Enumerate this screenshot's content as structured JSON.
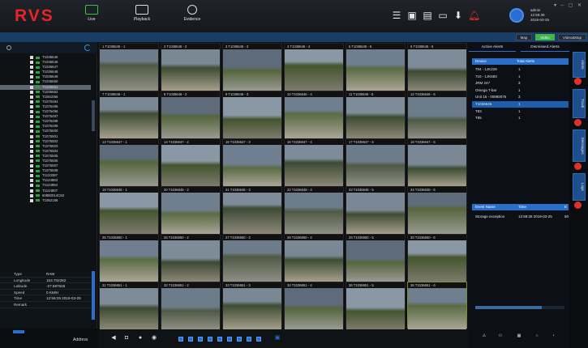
{
  "app": {
    "logo": "RVS"
  },
  "nav": [
    {
      "label": "Live"
    },
    {
      "label": "Playback"
    },
    {
      "label": "Evidence"
    }
  ],
  "toolbar_icons": [
    "list-icon",
    "monitor-icon",
    "document-icon",
    "message-icon",
    "download-icon",
    "bell-icon"
  ],
  "user": {
    "name": "admin",
    "time": "12:59:39",
    "date": "2019-03-25"
  },
  "window_controls": "▾ – ▢ ✕",
  "view_tabs": {
    "map": "Map",
    "video": "Video",
    "video_map": "Video&Map"
  },
  "tree": {
    "items": [
      "T1036645",
      "T1036646",
      "T1036647",
      "T1036648",
      "T1036649",
      "T1036650",
      "T1036651",
      "T1036652",
      "T1051056",
      "T1070484",
      "T1075495",
      "T1075496",
      "T1075497",
      "T1075498",
      "T1075499",
      "T1075500",
      "T1075501",
      "T1075502",
      "T1075503",
      "T1075504",
      "T1075505",
      "T1075506",
      "T1075507",
      "T1075508",
      "T1123387",
      "T1124983",
      "T1124984",
      "T1144807",
      "60880014C83",
      "T1052186"
    ],
    "selected_index": 6
  },
  "info": {
    "rows": [
      {
        "key": "Type",
        "value": "RAM"
      },
      {
        "key": "Longitude",
        "value": "153.702282"
      },
      {
        "key": "Latitude",
        "value": "-27.587645"
      },
      {
        "key": "Speed",
        "value": "0 KM/H"
      },
      {
        "key": "Time",
        "value": "12:59:29 2019-03-25"
      },
      {
        "key": "Remark",
        "value": ""
      }
    ],
    "address_label": "Address"
  },
  "grid": {
    "cells": [
      "T1036645 - 1",
      "T1036645 - 2",
      "T1036645 - 3",
      "T1036645 - 4",
      "T1036645 - 5",
      "T1036645 - 6",
      "T1036646 - 1",
      "T1036646 - 2",
      "T1036646 - 3",
      "T1036646 - 4",
      "T1036646 - 5",
      "T1036646 - 6",
      "T1036647 - 1",
      "T1036647 - 2",
      "T1036647 - 3",
      "T1036647 - 4",
      "T1036647 - 5",
      "T1036647 - 6",
      "T1036648 - 1",
      "T1036648 - 2",
      "T1036648 - 3",
      "T1036648 - 4",
      "T1036648 - 5",
      "T1036648 - 6",
      "T1036650 - 1",
      "T1036650 - 2",
      "T1036650 - 3",
      "T1036650 - 4",
      "T1036650 - 5",
      "T1036650 - 6",
      "T1036651 - 1",
      "T1036651 - 2",
      "T1036651 - 3",
      "T1036651 - 4",
      "T1036651 - 5",
      "T1036651 - 6"
    ],
    "numbers": [
      "1",
      "2",
      "3",
      "4",
      "5",
      "6",
      "7",
      "8",
      "9",
      "10",
      "11",
      "12",
      "13",
      "14",
      "15",
      "16",
      "17",
      "18",
      "19",
      "20",
      "21",
      "22",
      "23",
      "24",
      "25",
      "26",
      "27",
      "28",
      "29",
      "30",
      "31",
      "32",
      "33",
      "34",
      "35",
      "36"
    ]
  },
  "alerts": {
    "tab_active": "Active Alerts",
    "tab_dismissed": "Dismissed Alerts",
    "col_device": "Device",
    "col_total": "Total Alerts",
    "rows": [
      {
        "device": "704 - 1JK229",
        "total": "1"
      },
      {
        "device": "710 - 1JK683",
        "total": "1"
      },
      {
        "device": "JRM 247",
        "total": "3"
      },
      {
        "device": "Omega T-bar",
        "total": "1"
      },
      {
        "device": "Unit 15 - 00880075",
        "total": "3"
      },
      {
        "device": "T1036645",
        "total": "1"
      },
      {
        "device": "T83",
        "total": "1"
      },
      {
        "device": "T85",
        "total": "1"
      }
    ],
    "selected_index": 5,
    "events_col_name": "Event Name",
    "events_col_time": "Time",
    "events_col_extra": "E",
    "events": [
      {
        "name": "Storage exception",
        "time": "12:58:26 2019-03-25",
        "extra": "50"
      }
    ]
  },
  "side_tabs": [
    "Alerts",
    "Track",
    "Messages",
    "Logs"
  ],
  "colors": {
    "brand": "#e8232a",
    "accent": "#2b6ed1",
    "active_tab": "#3fb54a",
    "badge": "#e0302c"
  }
}
